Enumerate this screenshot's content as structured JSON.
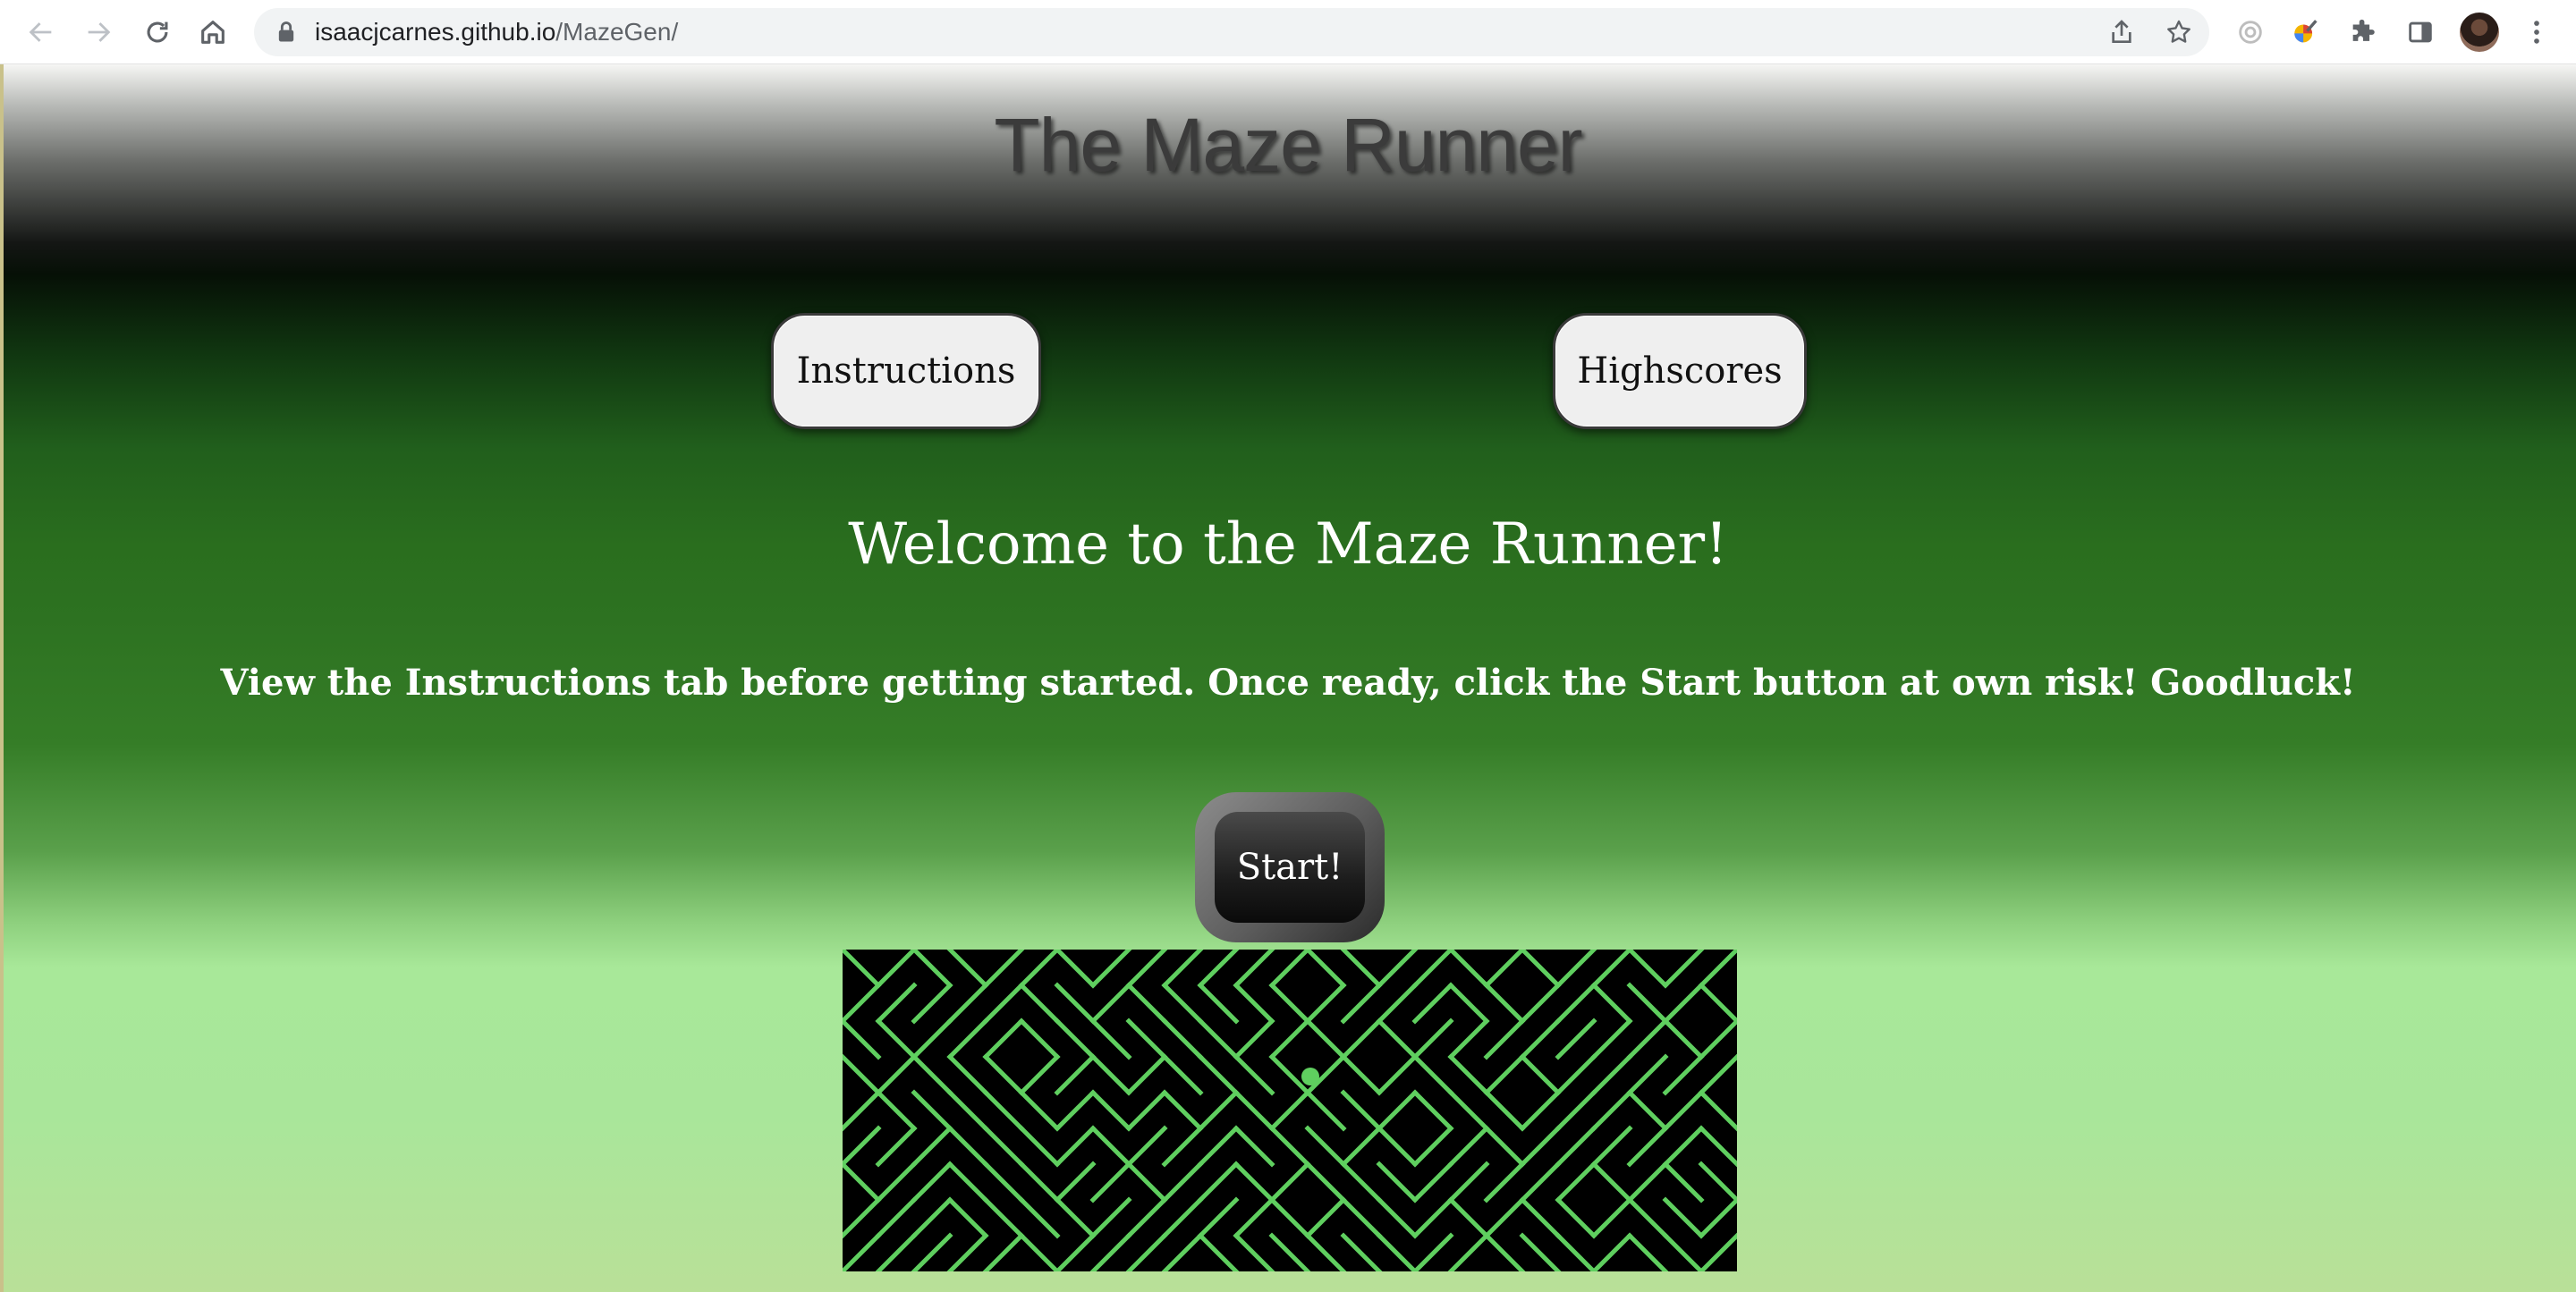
{
  "browser": {
    "url_host": "isaacjcarnes.github.io",
    "url_path": "/MazeGen/"
  },
  "page": {
    "title": "The Maze Runner",
    "instructions_label": "Instructions",
    "highscores_label": "Highscores",
    "welcome": "Welcome to the Maze Runner!",
    "subtitle": "View the Instructions tab before getting started. Once ready, click the Start button at own risk! Goodluck!",
    "start_label": "Start!"
  },
  "colors": {
    "maze_wall": "#5fcf5f",
    "maze_background": "#000000",
    "player_dot": "#5fcf5f"
  }
}
